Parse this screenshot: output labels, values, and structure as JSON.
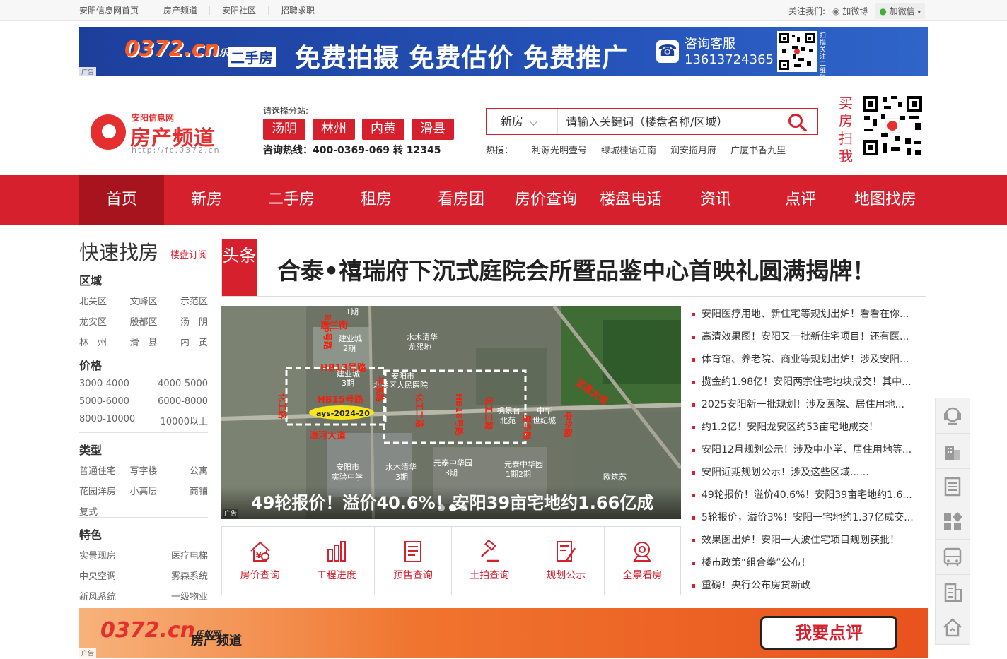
{
  "topbar": {
    "links": [
      "安阳信息网首页",
      "房产频道",
      "安阳社区",
      "招聘求职"
    ],
    "follow_label": "关注我们:",
    "weibo": "加微博",
    "weixin": "加微信"
  },
  "ad_top": {
    "logo": "0372.cn",
    "logo_sub": "乐蚁网",
    "tag": "二手房",
    "slogan": "免费拍摄 免费估价 免费推广",
    "service_label": "咨询客服",
    "service_phone": "13613724365",
    "qr_side": "扫描关注二维码",
    "ad_tag": "广告"
  },
  "header": {
    "site_name": "安阳信息网",
    "channel": "房产频道",
    "url": "http://fc.0372.cn",
    "branch_label": "请选择分站:",
    "branches": [
      "汤阴",
      "林州",
      "内黄",
      "滑县"
    ],
    "hotline": "咨询热线：400-0369-069 转 12345",
    "buy_label": "买房扫我"
  },
  "search": {
    "type": "新房",
    "placeholder": "请输入关键词（楼盘名称/区域）",
    "hot_label": "热搜：",
    "hot": [
      "利源光明壹号",
      "绿城桂语江南",
      "润安揽月府",
      "广厦书香九里"
    ]
  },
  "nav": [
    "首页",
    "新房",
    "二手房",
    "租房",
    "看房团",
    "房价查询",
    "楼盘电话",
    "资讯",
    "点评",
    "地图找房"
  ],
  "quick": {
    "title": "快速找房",
    "subscribe": "楼盘订阅",
    "area_title": "区域",
    "areas": [
      "北关区",
      "文峰区",
      "示范区",
      "龙安区",
      "殷都区",
      "汤　阴",
      "林　州",
      "滑　县",
      "内　黄"
    ],
    "price_title": "价格",
    "prices": [
      "3000-4000",
      "4000-5000",
      "5000-6000",
      "6000-8000",
      "8000-10000",
      "10000以上"
    ],
    "type_title": "类型",
    "types": [
      "普通住宅",
      "写字楼",
      "公寓",
      "花园洋房",
      "小高层",
      "商铺",
      "复式"
    ],
    "feature_title": "特色",
    "features": [
      "实景现房",
      "医疗电梯",
      "中央空调",
      "雾森系统",
      "新风系统",
      "一级物业"
    ]
  },
  "headline": {
    "tag": "头条",
    "text": "合泰•禧瑞府下沉式庭院会所暨品鉴中心首映礼圆满揭牌！"
  },
  "slider": {
    "caption": "49轮报价！溢价40.6%！安阳39亩宅地约1.66亿成交！",
    "ad_tag": "广告",
    "map_labels": [
      "B16号路",
      "惠兰街",
      "1期",
      "建业城2期",
      "水木清华龙熙地",
      "HB13号路",
      "建业城3期",
      "安阳市北关区人民医院",
      "平原路",
      "HB15号路",
      "化工路",
      "ays-2024-20",
      "漳河大道",
      "化工二路",
      "HB18号路",
      "化工三路",
      "枫景台北苑",
      "星华路",
      "中华世纪城",
      "中华路",
      "宝莲大道",
      "安阳市实验中学",
      "水木清华3期",
      "元泰中华园3期",
      "元泰中华园1期2期",
      "欧筑苏"
    ]
  },
  "tools": [
    "房价查询",
    "工程进度",
    "预售查询",
    "土拍查询",
    "规划公示",
    "全景看房"
  ],
  "news": [
    "安阳医疗用地、新住宅等规划出炉！看看在你...",
    "高清效果图！安阳又一批新住宅项目！还有医...",
    "体育馆、养老院、商业等规划出炉！涉及安阳...",
    "揽金约1.98亿！安阳两宗住宅地块成交！其中...",
    "2025安阳新一批规划！涉及医院、居住用地...",
    "约1.2亿！安阳龙安区约53亩宅地成交！",
    "安阳12月规划公示！涉及中小学、居住用地等...",
    "安阳近期规划公示！涉及这些区域......",
    "49轮报价！溢价40.6%！安阳39亩宅地约1.6...",
    "5轮报价，溢价3%！安阳一宅地约1.37亿成交...",
    "效果图出炉！安阳一大波住宅项目规划获批！",
    "楼市政策“组合拳”公布！",
    "重磅！央行公布房贷新政"
  ],
  "ad_bottom": {
    "logo": "0372.cn",
    "logo_sub": "乐蚁网",
    "channel": "房产频道",
    "button": "我要点评",
    "ad_tag": "广告"
  },
  "float_icons": [
    "customer-service-icon",
    "building-icon",
    "list-icon",
    "apps-icon",
    "bus-icon",
    "office-icon",
    "home-up-icon"
  ],
  "colors": {
    "brand_red": "#d7202e",
    "nav_active": "#a8141e"
  }
}
